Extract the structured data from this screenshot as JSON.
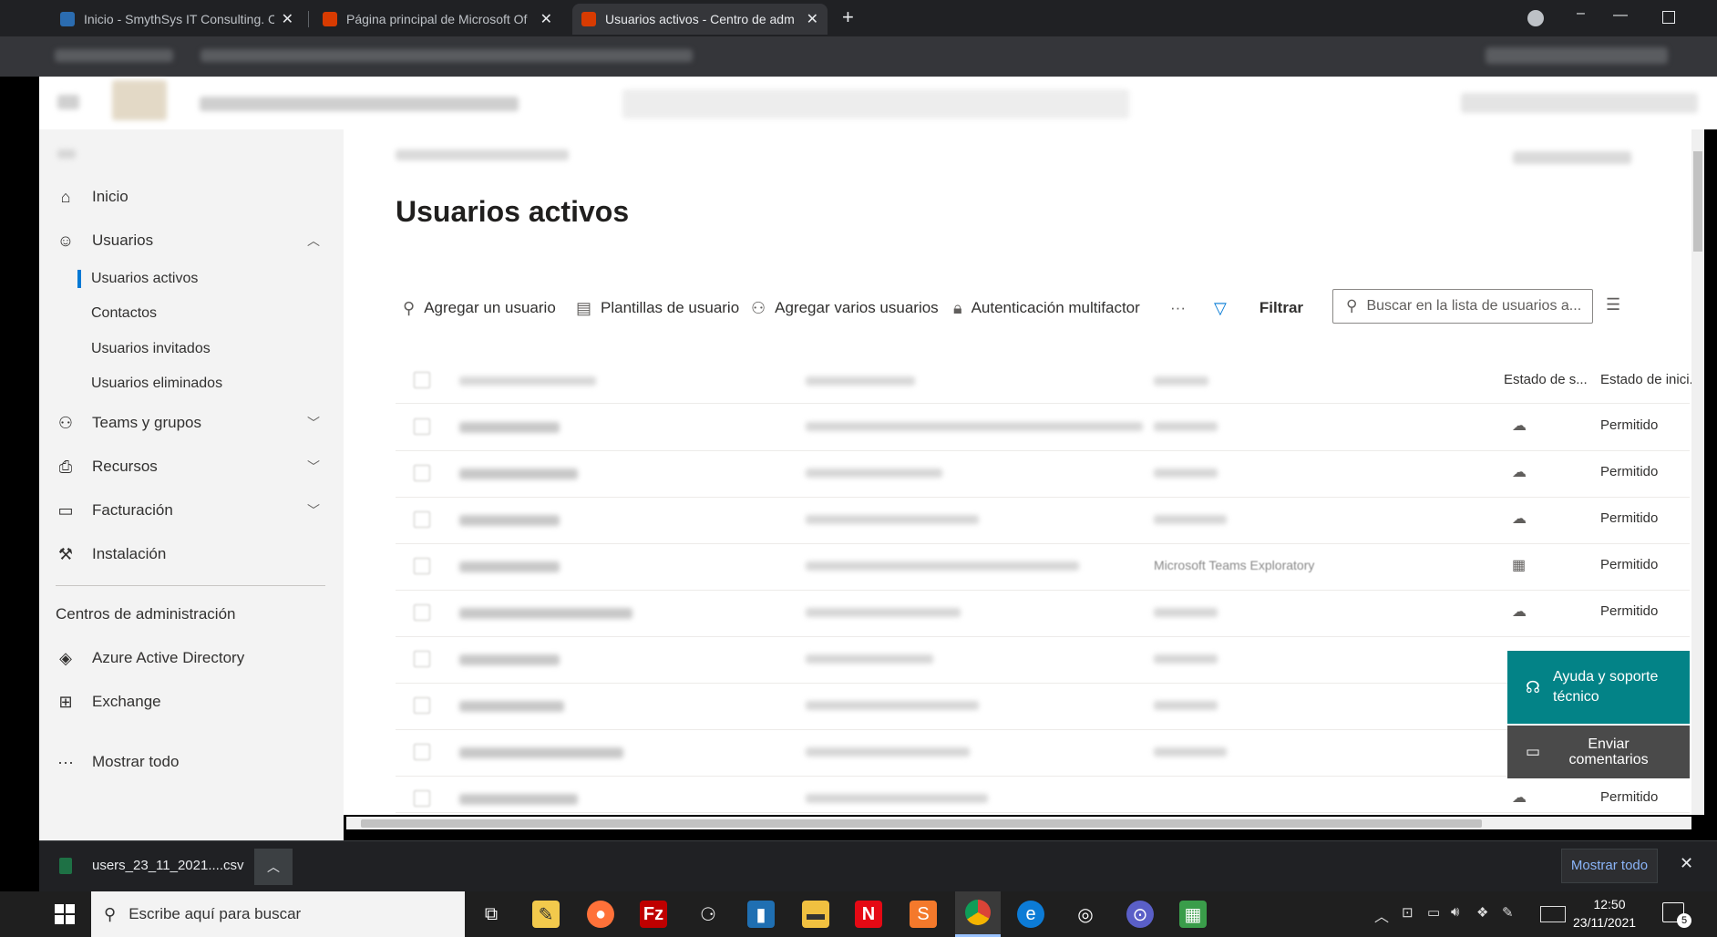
{
  "browser": {
    "tabs": [
      {
        "title": "Inicio - SmythSys IT Consulting. C",
        "color": "#2b6cb0"
      },
      {
        "title": "Página principal de Microsoft Of",
        "color": "#d83b01"
      },
      {
        "title": "Usuarios activos - Centro de adm",
        "color": "#d83b01"
      }
    ]
  },
  "page": {
    "title": "Usuarios activos"
  },
  "nav": {
    "items": [
      {
        "label": "Inicio"
      },
      {
        "label": "Usuarios"
      },
      {
        "label": "Teams y grupos"
      },
      {
        "label": "Recursos"
      },
      {
        "label": "Facturación"
      },
      {
        "label": "Instalación"
      }
    ],
    "subitems": [
      {
        "label": "Usuarios activos"
      },
      {
        "label": "Contactos"
      },
      {
        "label": "Usuarios invitados"
      },
      {
        "label": "Usuarios eliminados"
      }
    ],
    "admin_centers_heading": "Centros de administración",
    "admin_centers": [
      {
        "label": "Azure Active Directory"
      },
      {
        "label": "Exchange"
      }
    ],
    "show_all": "Mostrar todo"
  },
  "toolbar": {
    "add_user": "Agregar un usuario",
    "user_templates": "Plantillas de usuario",
    "add_multiple": "Agregar varios usuarios",
    "mfa": "Autenticación multifactor",
    "more": "···",
    "filter": "Filtrar",
    "search_placeholder": "Buscar en la lista de usuarios a..."
  },
  "table": {
    "columns": [
      "Estado de s...",
      "Estado de inici..."
    ],
    "rows": [
      {
        "status": "Permitido",
        "icon": "cloud-icon"
      },
      {
        "status": "Permitido",
        "icon": "cloud-icon"
      },
      {
        "status": "Permitido",
        "icon": "cloud-icon"
      },
      {
        "license": "Microsoft Teams Exploratory",
        "status": "Permitido",
        "icon": "calendar-icon"
      },
      {
        "status": "Permitido",
        "icon": "cloud-icon"
      },
      {
        "status": "",
        "icon": "cloud-icon"
      },
      {
        "status": "",
        "icon": "cloud-icon"
      },
      {
        "status": "",
        "icon": "cloud-icon"
      },
      {
        "status": "Permitido",
        "icon": "cloud-icon"
      }
    ]
  },
  "help_panel": {
    "support": "Ayuda y soporte técnico",
    "feedback": "Enviar comentarios",
    "support_color": "#038387",
    "feedback_color": "#4a4a4a"
  },
  "download_shelf": {
    "file": "users_23_11_2021....csv",
    "show_all": "Mostrar todo"
  },
  "taskbar": {
    "search_placeholder": "Escribe aquí para buscar",
    "time": "12:50",
    "date": "23/11/2021",
    "notifications": "5"
  }
}
